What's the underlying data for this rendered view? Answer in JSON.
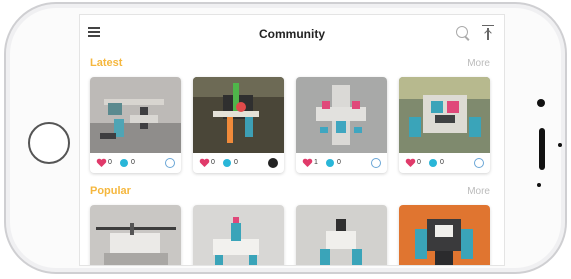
{
  "header": {
    "title": "Community"
  },
  "latest": {
    "title": "Latest",
    "more": "More",
    "cards": [
      {
        "likes": "0",
        "comments": "0",
        "avatar": "user-avatar-icon"
      },
      {
        "likes": "0",
        "comments": "0",
        "avatar": "user-avatar-dark-icon"
      },
      {
        "likes": "1",
        "comments": "0",
        "avatar": "user-avatar-icon"
      },
      {
        "likes": "0",
        "comments": "0",
        "avatar": "user-avatar-icon"
      }
    ]
  },
  "popular": {
    "title": "Popular",
    "more": "More"
  },
  "colors": {
    "accent": "#f5b73e",
    "like": "#e03a6a",
    "comment": "#29b6d8"
  }
}
